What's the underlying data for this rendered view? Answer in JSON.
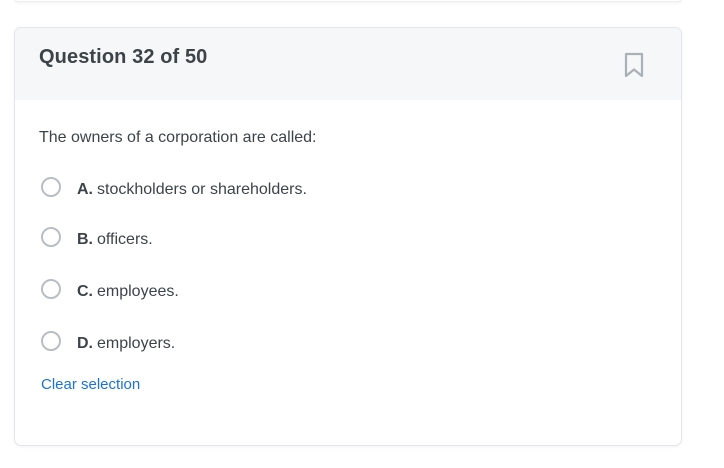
{
  "question": {
    "counter": "Question 32 of 50",
    "text": "The owners of a corporation are called:",
    "bookmark_icon": "bookmark-icon",
    "options": [
      {
        "letter": "A.",
        "text": "stockholders or shareholders."
      },
      {
        "letter": "B.",
        "text": "officers."
      },
      {
        "letter": "C.",
        "text": "employees."
      },
      {
        "letter": "D.",
        "text": "employers."
      }
    ],
    "clear_label": "Clear selection"
  },
  "colors": {
    "link": "#1a73d9",
    "header_bg": "#f6f7f9",
    "text": "#3d4449",
    "radio_border": "#b9bec4"
  }
}
